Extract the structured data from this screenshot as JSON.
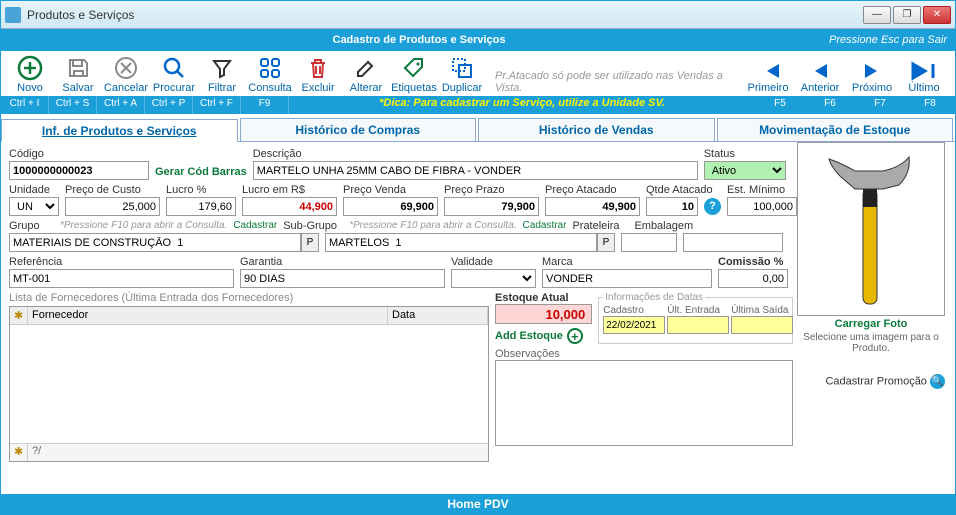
{
  "window": {
    "title": "Produtos e Serviços"
  },
  "header": {
    "title": "Cadastro de Produtos e Serviços",
    "hint": "Pressione Esc para Sair"
  },
  "toolbar": {
    "novo": "Novo",
    "salvar": "Salvar",
    "cancelar": "Cancelar",
    "procurar": "Procurar",
    "filtrar": "Filtrar",
    "consulta": "Consulta",
    "excluir": "Excluir",
    "alterar": "Alterar",
    "etiquetas": "Etiquetas",
    "duplicar": "Duplicar",
    "note": "Pr.Atacado só pode ser utilizado nas Vendas a Vista.",
    "primeiro": "Primeiro",
    "anterior": "Anterior",
    "proximo": "Próximo",
    "ultimo": "Último"
  },
  "shortcuts": {
    "c1": "Ctrl + I",
    "c2": "Ctrl + S",
    "c3": "Ctrl + A",
    "c4": "Ctrl + P",
    "c5": "Ctrl + F",
    "c6": "F9",
    "tip": "*Dica: Para cadastrar um Serviço, utilize a Unidade SV.",
    "f5": "F5",
    "f6": "F6",
    "f7": "F7",
    "f8": "F8"
  },
  "tabs": {
    "t1": "Inf. de Produtos e Serviços",
    "t2": "Histórico de Compras",
    "t3": "Histórico de Vendas",
    "t4": "Movimentação de Estoque"
  },
  "labels": {
    "codigo": "Código",
    "gerar": "Gerar Cód Barras",
    "descricao": "Descrição",
    "status": "Status",
    "unidade": "Unidade",
    "pcusto": "Preço de Custo",
    "lucropct": "Lucro %",
    "lucrors": "Lucro em R$",
    "pvenda": "Preço Venda",
    "pprazo": "Preço Prazo",
    "patacado": "Preço Atacado",
    "qtdeatacado": "Qtde Atacado",
    "estmin": "Est. Mínimo",
    "grupo": "Grupo",
    "subgrupo": "Sub-Grupo",
    "prateleira": "Prateleira",
    "embalagem": "Embalagem",
    "f10hint": "*Pressione F10 para abrir a Consulta.",
    "cadastrar": "Cadastrar",
    "referencia": "Referência",
    "garantia": "Garantia",
    "validade": "Validade",
    "marca": "Marca",
    "comissao": "Comissão %",
    "listaforn": "Lista de Fornecedores (Última Entrada dos Fornecedores)",
    "fornecedor": "Fornecedor",
    "data": "Data",
    "estoqueatual": "Estoque Atual",
    "addestoque": "Add Estoque",
    "infodatas": "Informações de Datas",
    "cadastro": "Cadastro",
    "ultentrada": "Últ. Entrada",
    "ultsaida": "Última Saída",
    "obs": "Observações",
    "carregarfoto": "Carregar Foto",
    "selecione": "Selecione uma imagem para o Produto.",
    "cadpromo": "Cadastrar Promoção",
    "footer_qty": "?/"
  },
  "values": {
    "codigo": "1000000000023",
    "descricao": "MARTELO UNHA 25MM CABO DE FIBRA - VONDER",
    "status": "Ativo",
    "unidade": "UN",
    "pcusto": "25,000",
    "lucropct": "179,60",
    "lucrors": "44,900",
    "pvenda": "69,900",
    "pprazo": "79,900",
    "patacado": "49,900",
    "qtdeatacado": "10",
    "estmin": "100,000",
    "grupo": "MATERIAIS DE CONSTRUÇÃO  1",
    "subgrupo": "MARTELOS  1",
    "prateleira": "",
    "embalagem": "",
    "referencia": "MT-001",
    "garantia": "90 DIAS",
    "validade": "",
    "marca": "VONDER",
    "comissao": "0,00",
    "estoqueatual": "10,000",
    "d_cadastro": "22/02/2021",
    "d_ultentrada": "",
    "d_ultsaida": "",
    "obs": ""
  },
  "statusbar": "Home PDV"
}
